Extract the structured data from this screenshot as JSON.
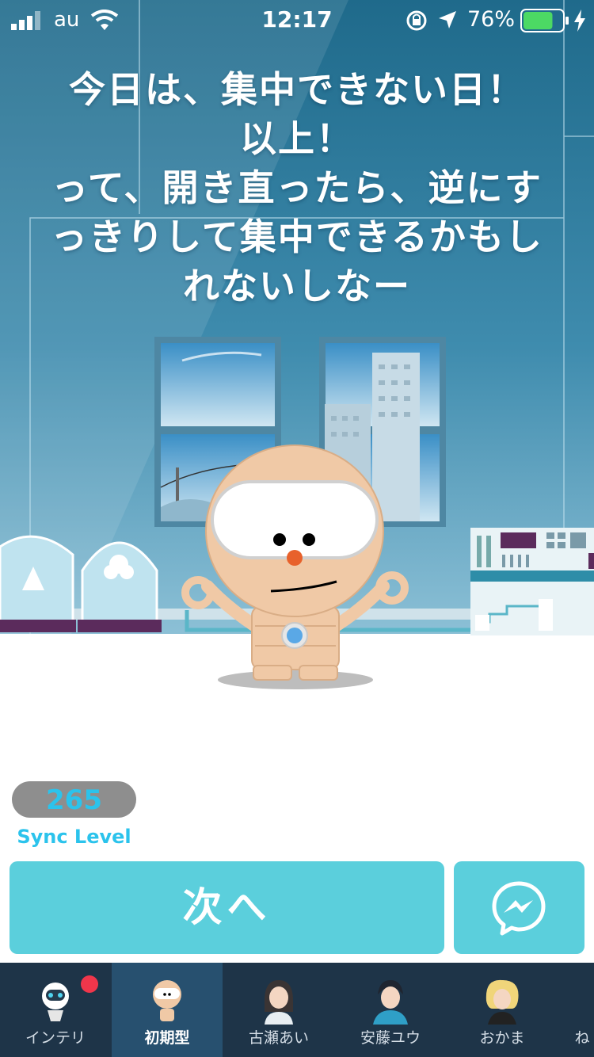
{
  "status_bar": {
    "carrier": "au",
    "time": "12:17",
    "battery_percent": "76%",
    "battery_level": 0.76,
    "icons": [
      "signal-icon",
      "wifi-icon",
      "rotation-lock-icon",
      "location-arrow-icon",
      "battery-icon",
      "charging-bolt-icon"
    ]
  },
  "message": {
    "lines": [
      "今日は、集中できない日！",
      "以上！",
      "って、開き直ったら、逆にす",
      "っきりして集中できるかもし",
      "れないしなー"
    ]
  },
  "sync": {
    "value": "265",
    "label": "Sync Level"
  },
  "actions": {
    "next_label": "次へ",
    "messenger_icon": "messenger-icon"
  },
  "tabs": [
    {
      "label": "インテリ",
      "icon": "robot-avatar-icon",
      "active": false,
      "badge": true
    },
    {
      "label": "初期型",
      "icon": "bald-robot-avatar-icon",
      "active": true,
      "badge": false
    },
    {
      "label": "古瀬あい",
      "icon": "woman-avatar-icon",
      "active": false,
      "badge": false
    },
    {
      "label": "安藤ユウ",
      "icon": "man-avatar-icon",
      "active": false,
      "badge": false
    },
    {
      "label": "おかま",
      "icon": "blonde-avatar-icon",
      "active": false,
      "badge": false
    },
    {
      "label": "ね",
      "icon": "more-avatar-icon",
      "active": false,
      "badge": false
    }
  ],
  "colors": {
    "accent": "#5bcfdc",
    "sync_text": "#2bc3ec",
    "tabbar": "#1e3448",
    "tab_active": "#27506f",
    "badge": "#f0364b",
    "wall_top": "#1e6d8f",
    "wall_bottom": "#7fb8d2"
  }
}
